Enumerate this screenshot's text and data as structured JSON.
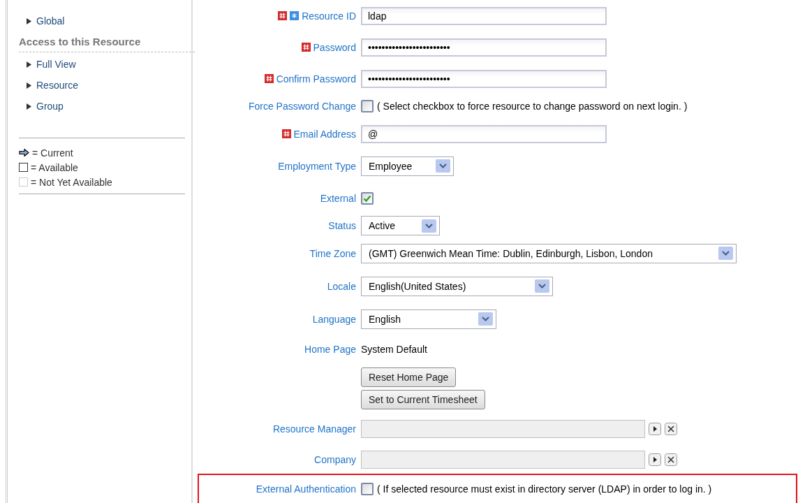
{
  "sidebar": {
    "top_items": [
      {
        "label": "Global"
      }
    ],
    "heading": "Access to this Resource",
    "items": [
      {
        "label": "Full View"
      },
      {
        "label": "Resource"
      },
      {
        "label": "Group"
      }
    ],
    "legend": [
      {
        "kind": "current",
        "label": "= Current"
      },
      {
        "kind": "available",
        "label": "= Available"
      },
      {
        "kind": "unavailable",
        "label": "= Not Yet Available"
      }
    ]
  },
  "form": {
    "rows": [
      {
        "kind": "text",
        "label": "Resource ID",
        "required": true,
        "key": true,
        "value": "ldap"
      },
      {
        "kind": "text",
        "label": "Password",
        "required": true,
        "key": false,
        "value": "••••••••••••••••••••••••"
      },
      {
        "kind": "text",
        "label": "Confirm Password",
        "required": true,
        "key": false,
        "value": "••••••••••••••••••••••••"
      },
      {
        "kind": "checkbox",
        "label": "Force Password Change",
        "required": false,
        "key": false,
        "checked": false,
        "hint": "( Select checkbox to force resource to change password on next login. )"
      },
      {
        "kind": "text",
        "label": "Email Address",
        "required": true,
        "key": false,
        "value": "@"
      },
      {
        "kind": "select",
        "label": "Employment Type",
        "required": false,
        "key": false,
        "value": "Employee"
      },
      {
        "kind": "checkbox",
        "label": "External",
        "required": false,
        "key": false,
        "checked": true
      },
      {
        "kind": "select",
        "label": "Status",
        "required": false,
        "key": false,
        "value": "Active"
      },
      {
        "kind": "select",
        "label": "Time Zone",
        "required": false,
        "key": false,
        "value": "(GMT) Greenwich Mean Time: Dublin, Edinburgh, Lisbon, London"
      },
      {
        "kind": "select",
        "label": "Locale",
        "required": false,
        "key": false,
        "value": "English(United States)"
      },
      {
        "kind": "select",
        "label": "Language",
        "required": false,
        "key": false,
        "value": "English"
      },
      {
        "kind": "display",
        "label": "Home Page",
        "required": false,
        "key": false,
        "value": "System Default"
      },
      {
        "kind": "buttons",
        "buttons": [
          "Reset Home Page",
          "Set to Current Timesheet"
        ]
      },
      {
        "kind": "lookup",
        "label": "Resource Manager",
        "required": false,
        "key": false
      },
      {
        "kind": "lookup",
        "label": "Company",
        "required": false,
        "key": false
      },
      {
        "kind": "checkbox",
        "label": "External Authentication",
        "required": false,
        "key": false,
        "checked": false,
        "highlighted": true,
        "hint": "( If selected resource must exist in directory server (LDAP) in order to log in. )"
      }
    ]
  }
}
